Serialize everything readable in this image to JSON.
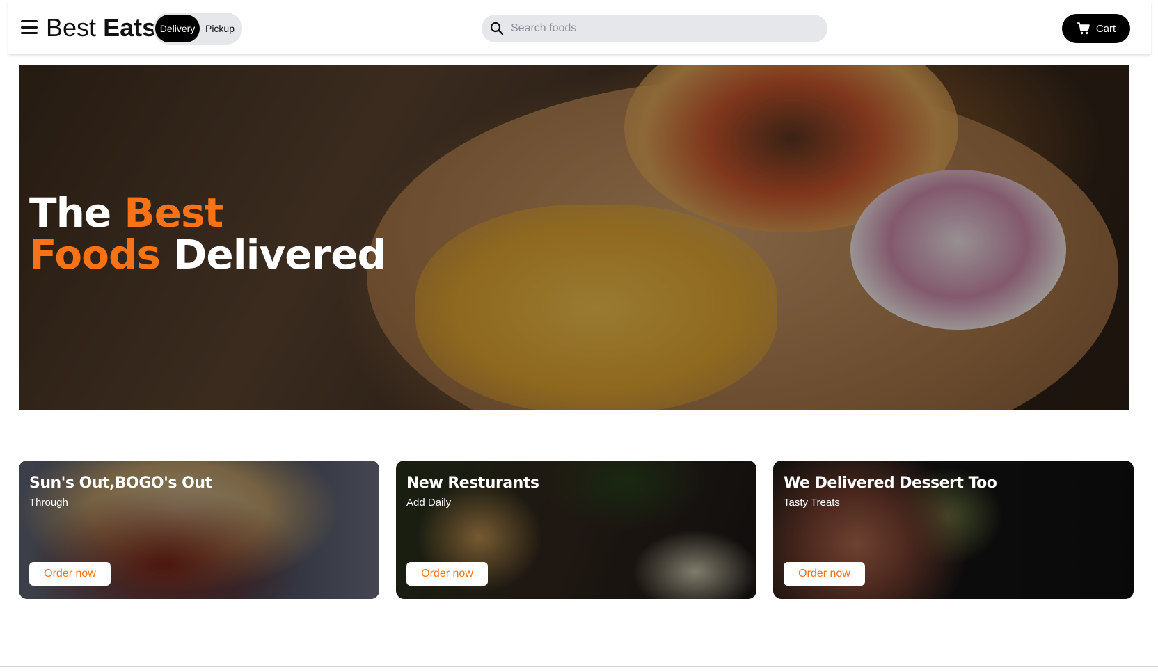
{
  "header": {
    "logo_regular": "Best",
    "logo_strong": "Eats",
    "delivery_label": "Delivery",
    "pickup_label": "Pickup",
    "search_placeholder": "Search foods",
    "cart_label": "Cart"
  },
  "hero": {
    "line1_white": "The",
    "line1_accent": "Best",
    "line2_accent": "Foods",
    "line2_white": "Delivered"
  },
  "cards": [
    {
      "title": "Sun's Out,BOGO's Out",
      "subtitle": "Through",
      "button": "Order now"
    },
    {
      "title": "New Resturants",
      "subtitle": "Add Daily",
      "button": "Order now"
    },
    {
      "title": "We Delivered Dessert Too",
      "subtitle": "Tasty Treats",
      "button": "Order now"
    }
  ],
  "colors": {
    "accent": "#f97316",
    "dark": "#000000",
    "pill_bg": "#e5e7eb"
  },
  "icons": [
    "menu-icon",
    "search-icon",
    "cart-icon"
  ]
}
